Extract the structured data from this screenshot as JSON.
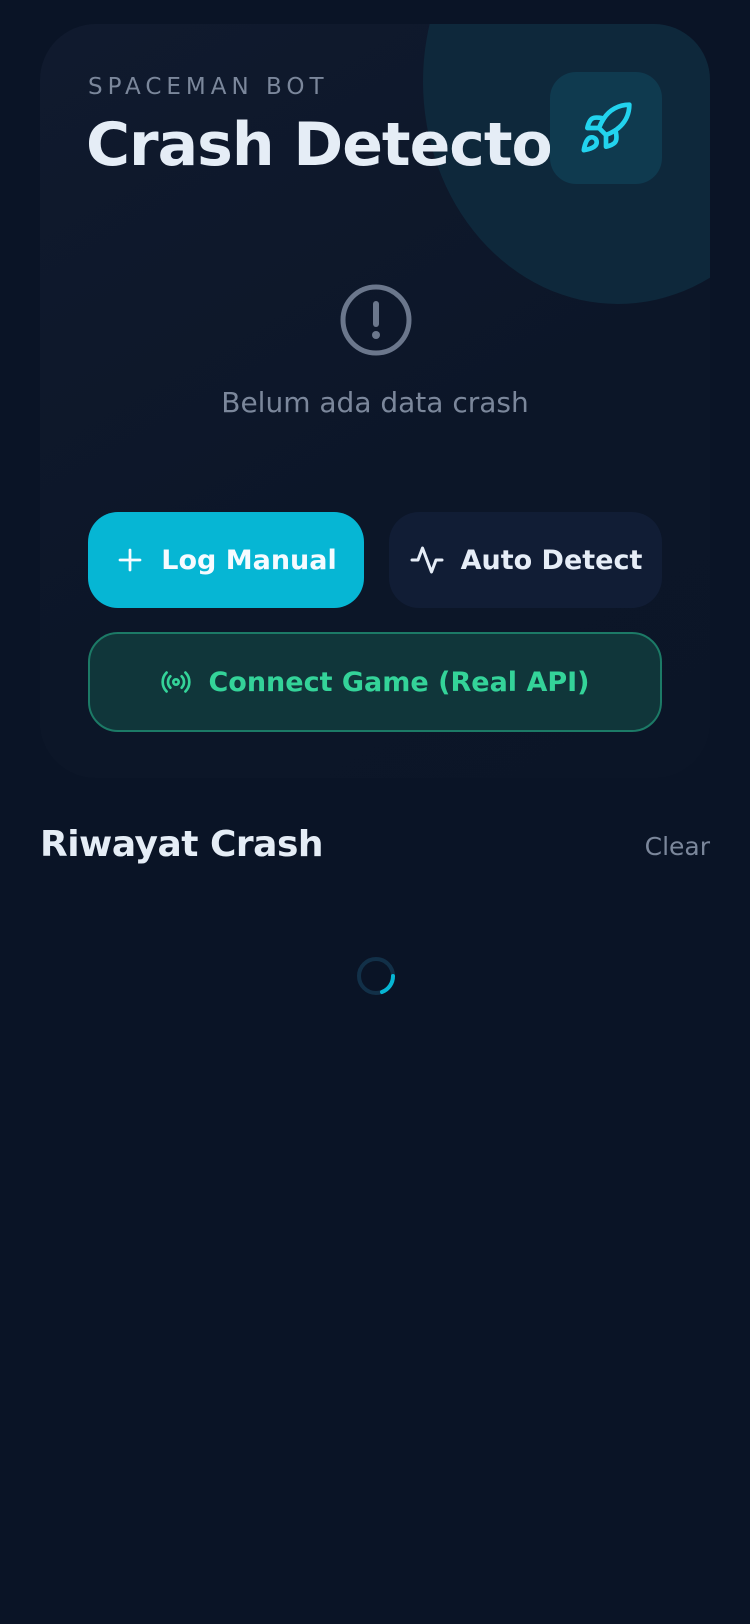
{
  "header": {
    "subtitle": "SPACEMAN BOT",
    "title": "Crash Detector",
    "icon": "rocket-icon"
  },
  "empty_state": {
    "icon": "alert-circle-icon",
    "message": "Belum ada data crash"
  },
  "actions": {
    "log_manual": {
      "label": "Log Manual",
      "icon": "plus-icon"
    },
    "auto_detect": {
      "label": "Auto Detect",
      "icon": "activity-icon"
    },
    "connect_game": {
      "label": "Connect Game (Real API)",
      "icon": "broadcast-icon"
    }
  },
  "history": {
    "title": "Riwayat Crash",
    "clear_label": "Clear",
    "status": "loading"
  },
  "colors": {
    "background": "#0a1426",
    "accent_cyan": "#06b6d4",
    "accent_green": "#34d399",
    "muted_text": "#7b879b"
  }
}
